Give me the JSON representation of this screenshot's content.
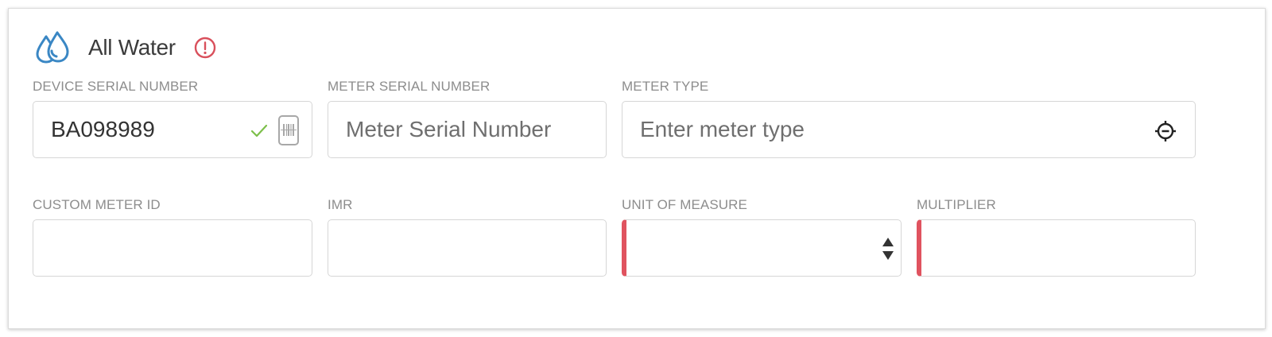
{
  "section": {
    "title": "All Water",
    "icon": "water-drops-icon",
    "alert_icon": "alert-circle-icon"
  },
  "fields": {
    "device_serial_number": {
      "label": "DEVICE SERIAL NUMBER",
      "value": "BA098989",
      "status_icon": "check-icon",
      "action_icon": "barcode-scan-icon"
    },
    "meter_serial_number": {
      "label": "METER SERIAL NUMBER",
      "value": "",
      "placeholder": "Meter Serial Number"
    },
    "meter_type": {
      "label": "METER TYPE",
      "value": "",
      "placeholder": "Enter meter type",
      "action_icon": "target-icon"
    },
    "custom_meter_id": {
      "label": "CUSTOM METER ID",
      "value": ""
    },
    "imr": {
      "label": "IMR",
      "value": ""
    },
    "unit_of_measure": {
      "label": "UNIT OF MEASURE",
      "value": "",
      "required": true,
      "action_icon": "stepper-arrows-icon"
    },
    "multiplier": {
      "label": "MULTIPLIER",
      "value": "",
      "required": true
    }
  },
  "colors": {
    "water_icon": "#3a87c4",
    "alert": "#d9505c",
    "check": "#7cbf4a",
    "required_marker": "#e0535f",
    "label_text": "#8d8d8d",
    "border": "#d6d6d6"
  }
}
